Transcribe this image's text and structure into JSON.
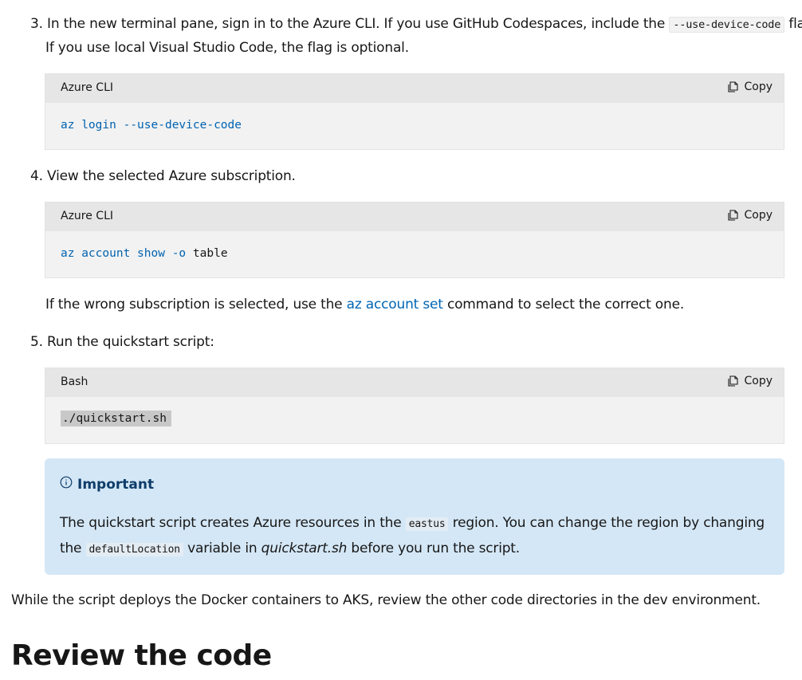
{
  "step3": {
    "number": "3.",
    "line1_before": "In the new terminal pane, sign in to the Azure CLI. If you use GitHub Codespaces, include the",
    "line1_code": "--use-device-code",
    "line1_after": "flag.",
    "line2": "If you use local Visual Studio Code, the flag is optional.",
    "code_block": {
      "language": "Azure CLI",
      "copy_label": "Copy",
      "tokens": [
        "az",
        "login",
        "--use-device-code"
      ]
    }
  },
  "step4": {
    "number": "4.",
    "text": "View the selected Azure subscription.",
    "code_block": {
      "language": "Azure CLI",
      "copy_label": "Copy",
      "tokens": [
        "az",
        "account",
        "show",
        "-o",
        "table"
      ]
    },
    "note_before": "If the wrong subscription is selected, use the",
    "note_link": "az account set",
    "note_after": "command to select the correct one."
  },
  "step5": {
    "number": "5.",
    "text": "Run the quickstart script:",
    "code_block": {
      "language": "Bash",
      "copy_label": "Copy",
      "code": "./quickstart.sh"
    }
  },
  "alert": {
    "title": "Important",
    "text_1": "The quickstart script creates Azure resources in the",
    "code_1": "eastus",
    "text_2": "region. You can change the region by changing the",
    "code_2": "defaultLocation",
    "text_3": "variable in",
    "italic": "quickstart.sh",
    "text_4": "before you run the script."
  },
  "paragraph": "While the script deploys the Docker containers to AKS, review the other code directories in the dev environment.",
  "heading": "Review the code"
}
